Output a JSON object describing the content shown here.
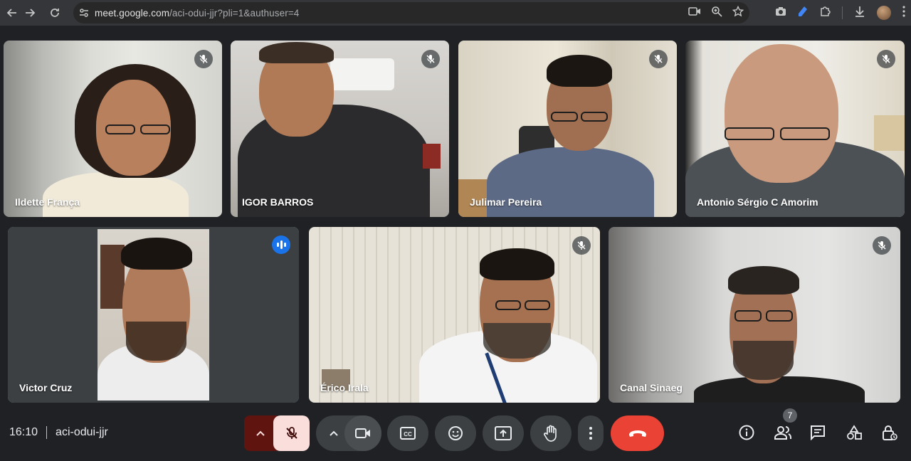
{
  "browser": {
    "url_host": "meet.google.com",
    "url_path": "/aci-odui-jjr?pli=1&authuser=4"
  },
  "participants": [
    {
      "name": "Ildette França",
      "muted": true
    },
    {
      "name": "IGOR BARROS",
      "muted": true
    },
    {
      "name": "Julimar Pereira",
      "muted": true
    },
    {
      "name": "Antonio Sérgio C Amorim",
      "muted": true
    },
    {
      "name": "Victor Cruz",
      "muted": false,
      "speaking": true
    },
    {
      "name": "Érico Irala",
      "muted": true
    },
    {
      "name": "Canal Sinaeg",
      "muted": true
    }
  ],
  "bottom_bar": {
    "time": "16:10",
    "meeting_code": "aci-odui-jjr",
    "people_count": "7"
  },
  "colors": {
    "background": "#202124",
    "active_border": "#8ab4f8",
    "speaking_badge": "#1a73e8",
    "hangup": "#ea4335",
    "mic_off_bg": "#f9dedc",
    "mic_caret_bg": "#601410"
  },
  "icons": {
    "toolbar": [
      "back-icon",
      "forward-icon",
      "reload-icon",
      "site-settings-icon",
      "camera-icon",
      "zoom-icon",
      "bookmark-star-icon",
      "screenshot-icon",
      "extension-pen-icon",
      "extensions-puzzle-icon",
      "download-icon"
    ],
    "meet": [
      "mic-off-icon",
      "camera-icon",
      "captions-icon",
      "emoji-icon",
      "present-icon",
      "raise-hand-icon",
      "more-options-icon",
      "hangup-icon",
      "info-icon",
      "people-icon",
      "chat-icon",
      "activities-icon",
      "host-controls-icon"
    ]
  }
}
